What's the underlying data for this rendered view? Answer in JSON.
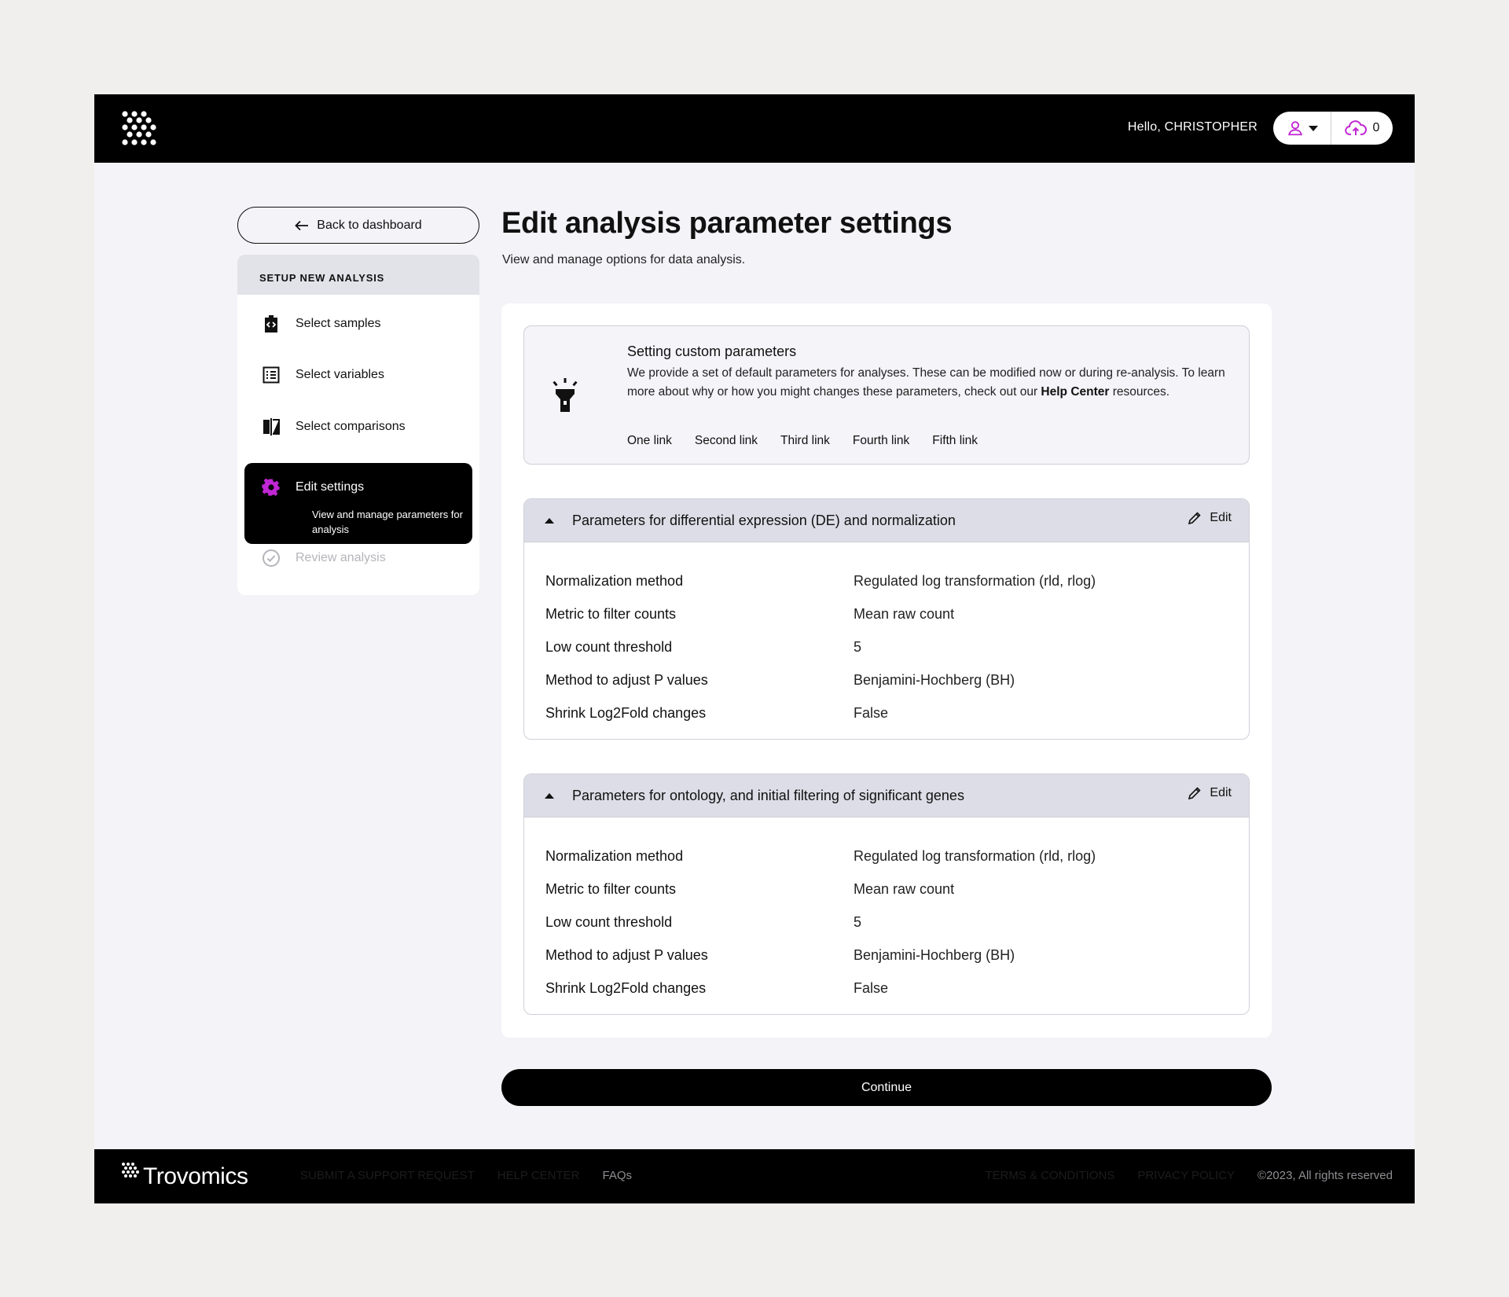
{
  "header": {
    "greeting": "Hello, CHRISTOPHER",
    "upload_count": "0"
  },
  "sidebar": {
    "back_label": "Back to dashboard",
    "section_title": "SETUP NEW ANALYSIS",
    "items": [
      {
        "label": "Select samples",
        "icon": "samples-icon"
      },
      {
        "label": "Select variables",
        "icon": "list-icon"
      },
      {
        "label": "Select comparisons",
        "icon": "compare-icon"
      },
      {
        "label": "Edit settings",
        "description": "View and manage parameters for analysis",
        "icon": "gear-icon",
        "active": true
      },
      {
        "label": "Review analysis",
        "icon": "check-circle-icon",
        "disabled": true
      }
    ]
  },
  "main": {
    "title": "Edit analysis parameter settings",
    "subtitle": "View and manage options for data analysis.",
    "info": {
      "title": "Setting custom parameters",
      "text_before": "We provide a set of default parameters for analyses. These can be modified now or during re-analysis. To learn more about why or how you might changes these parameters, check out our ",
      "help_link": "Help Center",
      "text_after": " resources.",
      "links": [
        "One link",
        "Second link",
        "Third link",
        "Fourth link",
        "Fifth link"
      ]
    },
    "sections": [
      {
        "title": "Parameters for differential expression (DE) and normalization",
        "edit_label": "Edit",
        "rows": [
          {
            "key": "Normalization method",
            "value": "Regulated log transformation (rld, rlog)"
          },
          {
            "key": "Metric to filter counts",
            "value": "Mean raw count"
          },
          {
            "key": "Low count threshold",
            "value": "5"
          },
          {
            "key": "Method to adjust P values",
            "value": "Benjamini-Hochberg (BH)"
          },
          {
            "key": "Shrink Log2Fold changes",
            "value": "False"
          }
        ]
      },
      {
        "title": "Parameters for ontology, and initial filtering of significant genes",
        "edit_label": "Edit",
        "rows": [
          {
            "key": "Normalization method",
            "value": "Regulated log transformation (rld, rlog)"
          },
          {
            "key": "Metric to filter counts",
            "value": "Mean raw count"
          },
          {
            "key": "Low count threshold",
            "value": "5"
          },
          {
            "key": "Method to adjust P values",
            "value": "Benjamini-Hochberg (BH)"
          },
          {
            "key": "Shrink Log2Fold changes",
            "value": "False"
          }
        ]
      }
    ],
    "continue_label": "Continue"
  },
  "footer": {
    "brand": "Trovomics",
    "links": [
      "SUBMIT A SUPPORT REQUEST",
      "HELP CENTER",
      "FAQs"
    ],
    "right_links": [
      "TERMS & CONDITIONS",
      "PRIVACY POLICY"
    ],
    "copyright": "©2023, All rights reserved"
  },
  "colors": {
    "accent": "#c026d3",
    "background": "#f3f3f8",
    "header": "#000000"
  }
}
